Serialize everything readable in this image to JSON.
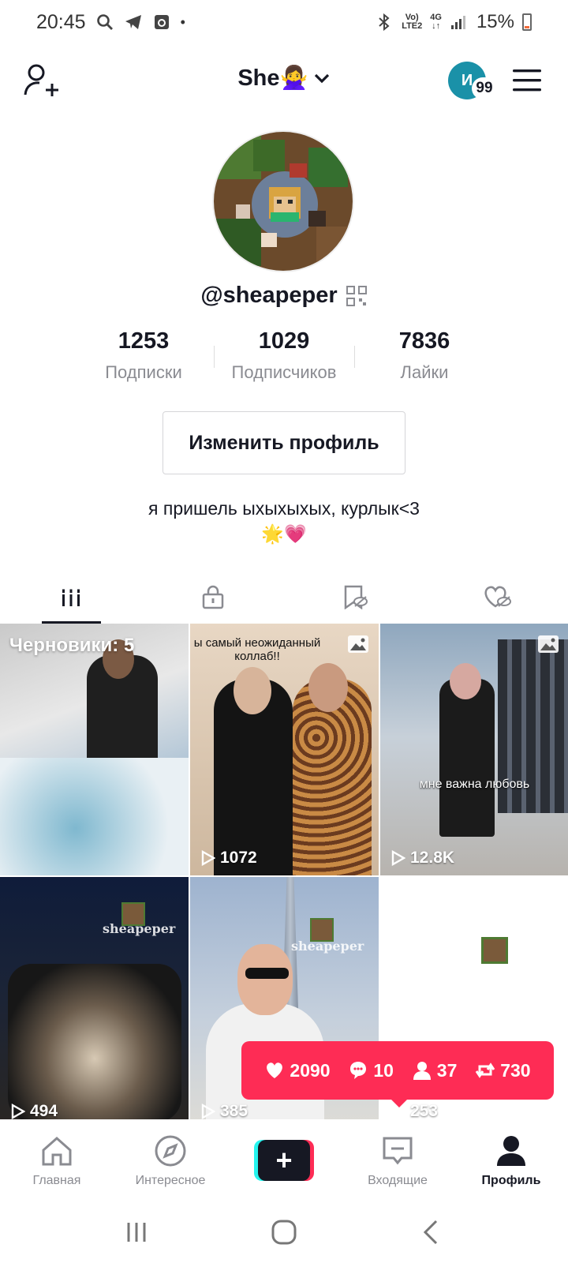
{
  "status_bar": {
    "time": "20:45",
    "network_top": "Vo)",
    "network_bottom": "LTE2",
    "network_gen": "4G",
    "battery": "15%"
  },
  "header": {
    "title": "She🙅‍♀️",
    "avatar_letter": "И",
    "avatar_badge": "99"
  },
  "profile": {
    "username": "@sheapeper",
    "stats": [
      {
        "value": "1253",
        "label": "Подписки"
      },
      {
        "value": "1029",
        "label": "Подписчиков"
      },
      {
        "value": "7836",
        "label": "Лайки"
      }
    ],
    "edit_button": "Изменить профиль",
    "bio_line1": "я пришель ыхыхыхых, курлык<3",
    "bio_line2": "🌟💗"
  },
  "tabs": [
    "videos-grid-icon",
    "lock-icon",
    "bookmark-hidden-icon",
    "heart-hidden-icon"
  ],
  "videos": [
    {
      "drafts_label": "Черновики: 5"
    },
    {
      "caption": "ы самый неожиданный\nколлаб!!",
      "views": "1072"
    },
    {
      "caption": "мне важна любовь",
      "views": "12.8K"
    },
    {
      "watermark": "sheapeper",
      "views": "494"
    },
    {
      "watermark": "sheapeper",
      "views": "385"
    },
    {
      "views": "253"
    }
  ],
  "notification": {
    "likes": "2090",
    "comments": "10",
    "followers": "37",
    "reposts": "730"
  },
  "bottom_nav": {
    "home": "Главная",
    "discover": "Интересное",
    "inbox": "Входящие",
    "profile": "Профиль"
  },
  "colors": {
    "accent": "#fe2c55",
    "cyan": "#25f4ee",
    "text": "#161823",
    "muted": "#8a8b91"
  }
}
